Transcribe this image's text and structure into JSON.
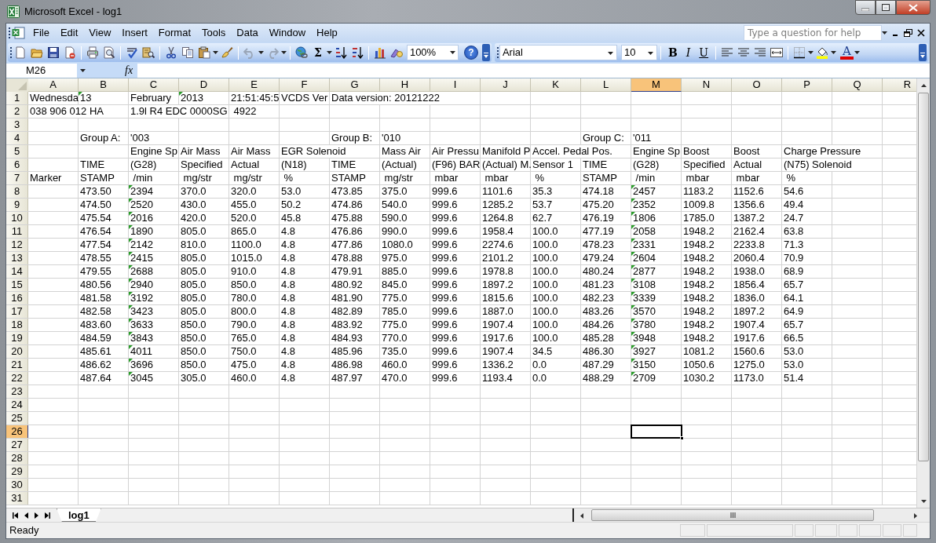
{
  "window": {
    "title": "Microsoft Excel - log1"
  },
  "menu": [
    {
      "label": "File"
    },
    {
      "label": "Edit"
    },
    {
      "label": "View"
    },
    {
      "label": "Insert"
    },
    {
      "label": "Format"
    },
    {
      "label": "Tools"
    },
    {
      "label": "Data"
    },
    {
      "label": "Window"
    },
    {
      "label": "Help"
    }
  ],
  "help_box": {
    "placeholder": "Type a question for help"
  },
  "standard_toolbar": {
    "autosum": "Σ",
    "zoom": "100%",
    "help": "?"
  },
  "formatting_toolbar": {
    "font": "Arial",
    "size": "10",
    "bold": "B",
    "italic": "I",
    "underline": "U",
    "font_color": "A"
  },
  "formula_bar": {
    "name_box": "M26",
    "function_label": "fx"
  },
  "sheet": {
    "columns": [
      {
        "label": "A",
        "selected": false
      },
      {
        "label": "B",
        "selected": false
      },
      {
        "label": "C",
        "selected": false
      },
      {
        "label": "D",
        "selected": false
      },
      {
        "label": "E",
        "selected": false
      },
      {
        "label": "F",
        "selected": false
      },
      {
        "label": "G",
        "selected": false
      },
      {
        "label": "H",
        "selected": false
      },
      {
        "label": "I",
        "selected": false
      },
      {
        "label": "J",
        "selected": false
      },
      {
        "label": "K",
        "selected": false
      },
      {
        "label": "L",
        "selected": false
      },
      {
        "label": "M",
        "selected": true
      },
      {
        "label": "N",
        "selected": false
      },
      {
        "label": "O",
        "selected": false
      },
      {
        "label": "P",
        "selected": false
      },
      {
        "label": "Q",
        "selected": false
      },
      {
        "label": "R",
        "selected": false
      }
    ],
    "rows": [
      {
        "number": "1",
        "selected": false,
        "cells": [
          {
            "text": "Wednesda",
            "flagged": false
          },
          {
            "text": "13",
            "flagged": true
          },
          {
            "text": "February",
            "flagged": false
          },
          {
            "text": "2013",
            "flagged": true
          },
          {
            "text": "21:51:45:5",
            "flagged": false
          },
          {
            "text": "VCDS Ver",
            "flagged": false
          },
          {
            "text": "Data version: 20121222",
            "flagged": false
          }
        ]
      },
      {
        "number": "2",
        "selected": false,
        "cells": [
          {
            "text": "038 906 012 HA",
            "flagged": false
          },
          null,
          {
            "text": "1.9l R4 EDC 0000SG",
            "flagged": false
          },
          null,
          {
            "text": " 4922",
            "flagged": false
          }
        ]
      },
      {
        "number": "3",
        "selected": false
      },
      {
        "number": "4",
        "selected": false,
        "cells": [
          null,
          {
            "text": "Group A:",
            "flagged": false
          },
          {
            "text": "'003",
            "flagged": false
          },
          null,
          null,
          null,
          {
            "text": "Group B:",
            "flagged": false
          },
          {
            "text": "'010",
            "flagged": false
          },
          null,
          null,
          null,
          {
            "text": "Group C:",
            "flagged": false
          },
          {
            "text": "'011",
            "flagged": false
          }
        ]
      },
      {
        "number": "5",
        "selected": false,
        "cells": [
          null,
          null,
          {
            "text": "Engine Sp",
            "flagged": false
          },
          {
            "text": "Air Mass",
            "flagged": false
          },
          {
            "text": "Air Mass",
            "flagged": false
          },
          {
            "text": "EGR Solenoid",
            "flagged": false
          },
          null,
          {
            "text": "Mass Air",
            "flagged": false
          },
          {
            "text": "Air Pressu",
            "flagged": false
          },
          {
            "text": "Manifold P",
            "flagged": false
          },
          {
            "text": "Accel. Pedal Pos.",
            "flagged": false
          },
          null,
          {
            "text": "Engine Sp",
            "flagged": false
          },
          {
            "text": "Boost",
            "flagged": false
          },
          {
            "text": "Boost",
            "flagged": false
          },
          {
            "text": "Charge Pressure",
            "flagged": false
          }
        ]
      },
      {
        "number": "6",
        "selected": false,
        "cells": [
          null,
          {
            "text": "TIME",
            "flagged": false
          },
          {
            "text": "(G28)",
            "flagged": false
          },
          {
            "text": "Specified",
            "flagged": false
          },
          {
            "text": "Actual",
            "flagged": false
          },
          {
            "text": "(N18)",
            "flagged": false
          },
          {
            "text": "TIME",
            "flagged": false
          },
          {
            "text": "(Actual)",
            "flagged": false
          },
          {
            "text": "(F96) BAR",
            "flagged": false
          },
          {
            "text": "(Actual) M.",
            "flagged": false
          },
          {
            "text": "Sensor 1",
            "flagged": false
          },
          {
            "text": "TIME",
            "flagged": false
          },
          {
            "text": "(G28)",
            "flagged": false
          },
          {
            "text": "Specified",
            "flagged": false
          },
          {
            "text": "Actual",
            "flagged": false
          },
          {
            "text": "(N75) Solenoid",
            "flagged": false
          }
        ]
      },
      {
        "number": "7",
        "selected": false,
        "cells": [
          {
            "text": "Marker",
            "flagged": false
          },
          {
            "text": "STAMP",
            "flagged": false
          },
          {
            "text": " /min",
            "flagged": false
          },
          {
            "text": " mg/str",
            "flagged": false
          },
          {
            "text": " mg/str",
            "flagged": false
          },
          {
            "text": " %",
            "flagged": false
          },
          {
            "text": "STAMP",
            "flagged": false
          },
          {
            "text": " mg/str",
            "flagged": false
          },
          {
            "text": " mbar",
            "flagged": false
          },
          {
            "text": " mbar",
            "flagged": false
          },
          {
            "text": " %",
            "flagged": false
          },
          {
            "text": "STAMP",
            "flagged": false
          },
          {
            "text": " /min",
            "flagged": false
          },
          {
            "text": " mbar",
            "flagged": false
          },
          {
            "text": " mbar",
            "flagged": false
          },
          {
            "text": " %",
            "flagged": false
          }
        ]
      },
      {
        "number": "8",
        "selected": false,
        "cells": [
          null,
          {
            "text": "473.50",
            "flagged": false
          },
          {
            "text": "2394",
            "flagged": true
          },
          {
            "text": "370.0",
            "flagged": false
          },
          {
            "text": "320.0",
            "flagged": false
          },
          {
            "text": "53.0",
            "flagged": false
          },
          {
            "text": "473.85",
            "flagged": false
          },
          {
            "text": "375.0",
            "flagged": false
          },
          {
            "text": "999.6",
            "flagged": false
          },
          {
            "text": "1101.6",
            "flagged": false
          },
          {
            "text": "35.3",
            "flagged": false
          },
          {
            "text": "474.18",
            "flagged": false
          },
          {
            "text": "2457",
            "flagged": true
          },
          {
            "text": "1183.2",
            "flagged": false
          },
          {
            "text": "1152.6",
            "flagged": false
          },
          {
            "text": "54.6",
            "flagged": false
          }
        ]
      },
      {
        "number": "9",
        "selected": false,
        "cells": [
          null,
          {
            "text": "474.50",
            "flagged": false
          },
          {
            "text": "2520",
            "flagged": true
          },
          {
            "text": "430.0",
            "flagged": false
          },
          {
            "text": "455.0",
            "flagged": false
          },
          {
            "text": "50.2",
            "flagged": false
          },
          {
            "text": "474.86",
            "flagged": false
          },
          {
            "text": "540.0",
            "flagged": false
          },
          {
            "text": "999.6",
            "flagged": false
          },
          {
            "text": "1285.2",
            "flagged": false
          },
          {
            "text": "53.7",
            "flagged": false
          },
          {
            "text": "475.20",
            "flagged": false
          },
          {
            "text": "2352",
            "flagged": true
          },
          {
            "text": "1009.8",
            "flagged": false
          },
          {
            "text": "1356.6",
            "flagged": false
          },
          {
            "text": "49.4",
            "flagged": false
          }
        ]
      },
      {
        "number": "10",
        "selected": false,
        "cells": [
          null,
          {
            "text": "475.54",
            "flagged": false
          },
          {
            "text": "2016",
            "flagged": true
          },
          {
            "text": "420.0",
            "flagged": false
          },
          {
            "text": "520.0",
            "flagged": false
          },
          {
            "text": "45.8",
            "flagged": false
          },
          {
            "text": "475.88",
            "flagged": false
          },
          {
            "text": "590.0",
            "flagged": false
          },
          {
            "text": "999.6",
            "flagged": false
          },
          {
            "text": "1264.8",
            "flagged": false
          },
          {
            "text": "62.7",
            "flagged": false
          },
          {
            "text": "476.19",
            "flagged": false
          },
          {
            "text": "1806",
            "flagged": true
          },
          {
            "text": "1785.0",
            "flagged": false
          },
          {
            "text": "1387.2",
            "flagged": false
          },
          {
            "text": "24.7",
            "flagged": false
          }
        ]
      },
      {
        "number": "11",
        "selected": false,
        "cells": [
          null,
          {
            "text": "476.54",
            "flagged": false
          },
          {
            "text": "1890",
            "flagged": true
          },
          {
            "text": "805.0",
            "flagged": false
          },
          {
            "text": "865.0",
            "flagged": false
          },
          {
            "text": "4.8",
            "flagged": false
          },
          {
            "text": "476.86",
            "flagged": false
          },
          {
            "text": "990.0",
            "flagged": false
          },
          {
            "text": "999.6",
            "flagged": false
          },
          {
            "text": "1958.4",
            "flagged": false
          },
          {
            "text": "100.0",
            "flagged": false
          },
          {
            "text": "477.19",
            "flagged": false
          },
          {
            "text": "2058",
            "flagged": true
          },
          {
            "text": "1948.2",
            "flagged": false
          },
          {
            "text": "2162.4",
            "flagged": false
          },
          {
            "text": "63.8",
            "flagged": false
          }
        ]
      },
      {
        "number": "12",
        "selected": false,
        "cells": [
          null,
          {
            "text": "477.54",
            "flagged": false
          },
          {
            "text": "2142",
            "flagged": true
          },
          {
            "text": "810.0",
            "flagged": false
          },
          {
            "text": "1100.0",
            "flagged": false
          },
          {
            "text": "4.8",
            "flagged": false
          },
          {
            "text": "477.86",
            "flagged": false
          },
          {
            "text": "1080.0",
            "flagged": false
          },
          {
            "text": "999.6",
            "flagged": false
          },
          {
            "text": "2274.6",
            "flagged": false
          },
          {
            "text": "100.0",
            "flagged": false
          },
          {
            "text": "478.23",
            "flagged": false
          },
          {
            "text": "2331",
            "flagged": true
          },
          {
            "text": "1948.2",
            "flagged": false
          },
          {
            "text": "2233.8",
            "flagged": false
          },
          {
            "text": "71.3",
            "flagged": false
          }
        ]
      },
      {
        "number": "13",
        "selected": false,
        "cells": [
          null,
          {
            "text": "478.55",
            "flagged": false
          },
          {
            "text": "2415",
            "flagged": true
          },
          {
            "text": "805.0",
            "flagged": false
          },
          {
            "text": "1015.0",
            "flagged": false
          },
          {
            "text": "4.8",
            "flagged": false
          },
          {
            "text": "478.88",
            "flagged": false
          },
          {
            "text": "975.0",
            "flagged": false
          },
          {
            "text": "999.6",
            "flagged": false
          },
          {
            "text": "2101.2",
            "flagged": false
          },
          {
            "text": "100.0",
            "flagged": false
          },
          {
            "text": "479.24",
            "flagged": false
          },
          {
            "text": "2604",
            "flagged": true
          },
          {
            "text": "1948.2",
            "flagged": false
          },
          {
            "text": "2060.4",
            "flagged": false
          },
          {
            "text": "70.9",
            "flagged": false
          }
        ]
      },
      {
        "number": "14",
        "selected": false,
        "cells": [
          null,
          {
            "text": "479.55",
            "flagged": false
          },
          {
            "text": "2688",
            "flagged": true
          },
          {
            "text": "805.0",
            "flagged": false
          },
          {
            "text": "910.0",
            "flagged": false
          },
          {
            "text": "4.8",
            "flagged": false
          },
          {
            "text": "479.91",
            "flagged": false
          },
          {
            "text": "885.0",
            "flagged": false
          },
          {
            "text": "999.6",
            "flagged": false
          },
          {
            "text": "1978.8",
            "flagged": false
          },
          {
            "text": "100.0",
            "flagged": false
          },
          {
            "text": "480.24",
            "flagged": false
          },
          {
            "text": "2877",
            "flagged": true
          },
          {
            "text": "1948.2",
            "flagged": false
          },
          {
            "text": "1938.0",
            "flagged": false
          },
          {
            "text": "68.9",
            "flagged": false
          }
        ]
      },
      {
        "number": "15",
        "selected": false,
        "cells": [
          null,
          {
            "text": "480.56",
            "flagged": false
          },
          {
            "text": "2940",
            "flagged": true
          },
          {
            "text": "805.0",
            "flagged": false
          },
          {
            "text": "850.0",
            "flagged": false
          },
          {
            "text": "4.8",
            "flagged": false
          },
          {
            "text": "480.92",
            "flagged": false
          },
          {
            "text": "845.0",
            "flagged": false
          },
          {
            "text": "999.6",
            "flagged": false
          },
          {
            "text": "1897.2",
            "flagged": false
          },
          {
            "text": "100.0",
            "flagged": false
          },
          {
            "text": "481.23",
            "flagged": false
          },
          {
            "text": "3108",
            "flagged": true
          },
          {
            "text": "1948.2",
            "flagged": false
          },
          {
            "text": "1856.4",
            "flagged": false
          },
          {
            "text": "65.7",
            "flagged": false
          }
        ]
      },
      {
        "number": "16",
        "selected": false,
        "cells": [
          null,
          {
            "text": "481.58",
            "flagged": false
          },
          {
            "text": "3192",
            "flagged": true
          },
          {
            "text": "805.0",
            "flagged": false
          },
          {
            "text": "780.0",
            "flagged": false
          },
          {
            "text": "4.8",
            "flagged": false
          },
          {
            "text": "481.90",
            "flagged": false
          },
          {
            "text": "775.0",
            "flagged": false
          },
          {
            "text": "999.6",
            "flagged": false
          },
          {
            "text": "1815.6",
            "flagged": false
          },
          {
            "text": "100.0",
            "flagged": false
          },
          {
            "text": "482.23",
            "flagged": false
          },
          {
            "text": "3339",
            "flagged": true
          },
          {
            "text": "1948.2",
            "flagged": false
          },
          {
            "text": "1836.0",
            "flagged": false
          },
          {
            "text": "64.1",
            "flagged": false
          }
        ]
      },
      {
        "number": "17",
        "selected": false,
        "cells": [
          null,
          {
            "text": "482.58",
            "flagged": false
          },
          {
            "text": "3423",
            "flagged": true
          },
          {
            "text": "805.0",
            "flagged": false
          },
          {
            "text": "800.0",
            "flagged": false
          },
          {
            "text": "4.8",
            "flagged": false
          },
          {
            "text": "482.89",
            "flagged": false
          },
          {
            "text": "785.0",
            "flagged": false
          },
          {
            "text": "999.6",
            "flagged": false
          },
          {
            "text": "1887.0",
            "flagged": false
          },
          {
            "text": "100.0",
            "flagged": false
          },
          {
            "text": "483.26",
            "flagged": false
          },
          {
            "text": "3570",
            "flagged": true
          },
          {
            "text": "1948.2",
            "flagged": false
          },
          {
            "text": "1897.2",
            "flagged": false
          },
          {
            "text": "64.9",
            "flagged": false
          }
        ]
      },
      {
        "number": "18",
        "selected": false,
        "cells": [
          null,
          {
            "text": "483.60",
            "flagged": false
          },
          {
            "text": "3633",
            "flagged": true
          },
          {
            "text": "850.0",
            "flagged": false
          },
          {
            "text": "790.0",
            "flagged": false
          },
          {
            "text": "4.8",
            "flagged": false
          },
          {
            "text": "483.92",
            "flagged": false
          },
          {
            "text": "775.0",
            "flagged": false
          },
          {
            "text": "999.6",
            "flagged": false
          },
          {
            "text": "1907.4",
            "flagged": false
          },
          {
            "text": "100.0",
            "flagged": false
          },
          {
            "text": "484.26",
            "flagged": false
          },
          {
            "text": "3780",
            "flagged": true
          },
          {
            "text": "1948.2",
            "flagged": false
          },
          {
            "text": "1907.4",
            "flagged": false
          },
          {
            "text": "65.7",
            "flagged": false
          }
        ]
      },
      {
        "number": "19",
        "selected": false,
        "cells": [
          null,
          {
            "text": "484.59",
            "flagged": false
          },
          {
            "text": "3843",
            "flagged": true
          },
          {
            "text": "850.0",
            "flagged": false
          },
          {
            "text": "765.0",
            "flagged": false
          },
          {
            "text": "4.8",
            "flagged": false
          },
          {
            "text": "484.93",
            "flagged": false
          },
          {
            "text": "770.0",
            "flagged": false
          },
          {
            "text": "999.6",
            "flagged": false
          },
          {
            "text": "1917.6",
            "flagged": false
          },
          {
            "text": "100.0",
            "flagged": false
          },
          {
            "text": "485.28",
            "flagged": false
          },
          {
            "text": "3948",
            "flagged": true
          },
          {
            "text": "1948.2",
            "flagged": false
          },
          {
            "text": "1917.6",
            "flagged": false
          },
          {
            "text": "66.5",
            "flagged": false
          }
        ]
      },
      {
        "number": "20",
        "selected": false,
        "cells": [
          null,
          {
            "text": "485.61",
            "flagged": false
          },
          {
            "text": "4011",
            "flagged": true
          },
          {
            "text": "850.0",
            "flagged": false
          },
          {
            "text": "750.0",
            "flagged": false
          },
          {
            "text": "4.8",
            "flagged": false
          },
          {
            "text": "485.96",
            "flagged": false
          },
          {
            "text": "735.0",
            "flagged": false
          },
          {
            "text": "999.6",
            "flagged": false
          },
          {
            "text": "1907.4",
            "flagged": false
          },
          {
            "text": "34.5",
            "flagged": false
          },
          {
            "text": "486.30",
            "flagged": false
          },
          {
            "text": "3927",
            "flagged": true
          },
          {
            "text": "1081.2",
            "flagged": false
          },
          {
            "text": "1560.6",
            "flagged": false
          },
          {
            "text": "53.0",
            "flagged": false
          }
        ]
      },
      {
        "number": "21",
        "selected": false,
        "cells": [
          null,
          {
            "text": "486.62",
            "flagged": false
          },
          {
            "text": "3696",
            "flagged": true
          },
          {
            "text": "850.0",
            "flagged": false
          },
          {
            "text": "475.0",
            "flagged": false
          },
          {
            "text": "4.8",
            "flagged": false
          },
          {
            "text": "486.98",
            "flagged": false
          },
          {
            "text": "460.0",
            "flagged": false
          },
          {
            "text": "999.6",
            "flagged": false
          },
          {
            "text": "1336.2",
            "flagged": false
          },
          {
            "text": "0.0",
            "flagged": false
          },
          {
            "text": "487.29",
            "flagged": false
          },
          {
            "text": "3150",
            "flagged": true
          },
          {
            "text": "1050.6",
            "flagged": false
          },
          {
            "text": "1275.0",
            "flagged": false
          },
          {
            "text": "53.0",
            "flagged": false
          }
        ]
      },
      {
        "number": "22",
        "selected": false,
        "cells": [
          null,
          {
            "text": "487.64",
            "flagged": false
          },
          {
            "text": "3045",
            "flagged": true
          },
          {
            "text": "305.0",
            "flagged": false
          },
          {
            "text": "460.0",
            "flagged": false
          },
          {
            "text": "4.8",
            "flagged": false
          },
          {
            "text": "487.97",
            "flagged": false
          },
          {
            "text": "470.0",
            "flagged": false
          },
          {
            "text": "999.6",
            "flagged": false
          },
          {
            "text": "1193.4",
            "flagged": false
          },
          {
            "text": "0.0",
            "flagged": false
          },
          {
            "text": "488.29",
            "flagged": false
          },
          {
            "text": "2709",
            "flagged": true
          },
          {
            "text": "1030.2",
            "flagged": false
          },
          {
            "text": "1173.0",
            "flagged": false
          },
          {
            "text": "51.4",
            "flagged": false
          }
        ]
      },
      {
        "number": "23",
        "selected": false
      },
      {
        "number": "24",
        "selected": false
      },
      {
        "number": "25",
        "selected": false
      },
      {
        "number": "26",
        "selected": true
      },
      {
        "number": "27",
        "selected": false
      },
      {
        "number": "28",
        "selected": false
      },
      {
        "number": "29",
        "selected": false
      },
      {
        "number": "30",
        "selected": false
      },
      {
        "number": "31",
        "selected": false
      }
    ]
  },
  "sheet_tabs": [
    {
      "label": "log1",
      "selected": true
    }
  ],
  "status_bar": {
    "text": "Ready"
  }
}
